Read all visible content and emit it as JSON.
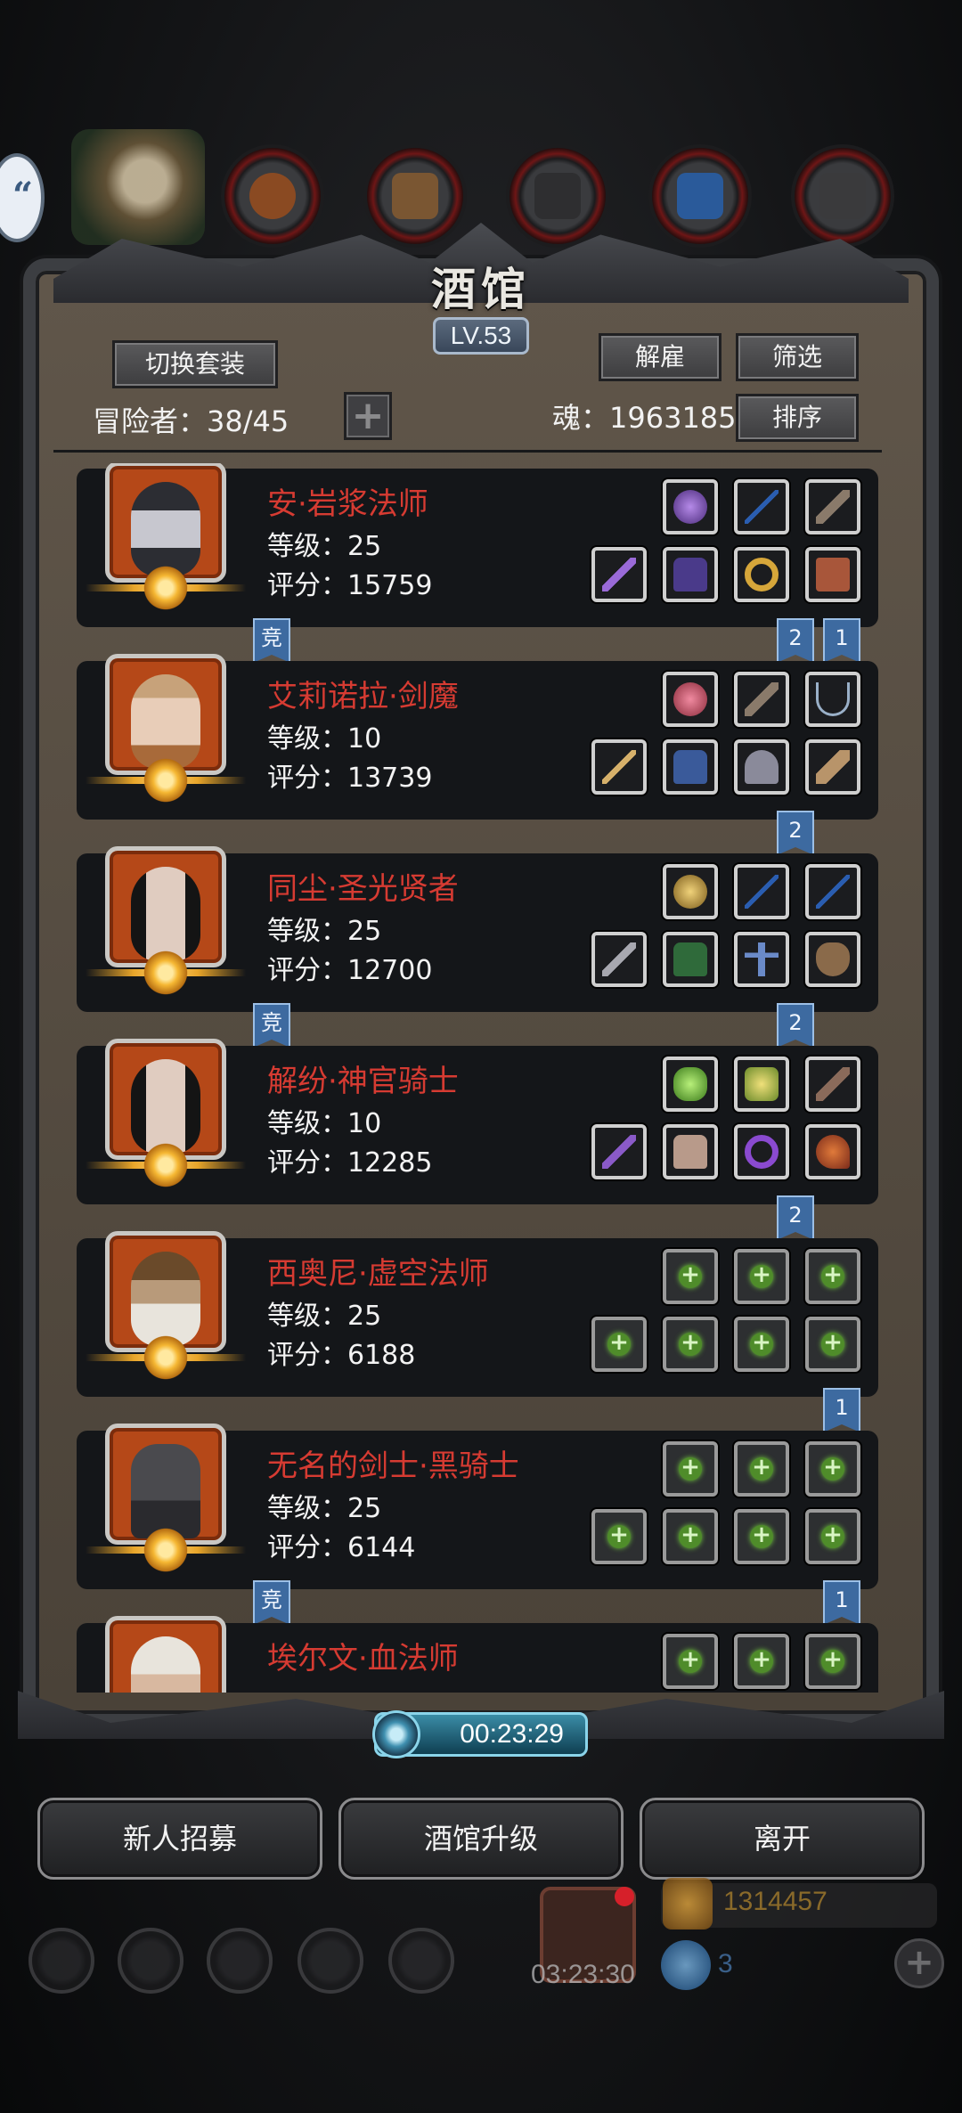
{
  "header": {
    "title": "酒馆",
    "level": "LV.53"
  },
  "toolbar": {
    "switch_outfit": "切换套装",
    "dismiss": "解雇",
    "filter": "筛选",
    "sort": "排序",
    "plus": "+",
    "adventurers_label": "冒险者：38/45",
    "soul_label": "魂：1963185"
  },
  "heroes": [
    {
      "name": "安·岩浆法师",
      "level": "等级：25",
      "score": "评分：15759",
      "tags": [
        "竞",
        "2",
        "1"
      ]
    },
    {
      "name": "艾莉诺拉·剑魔",
      "level": "等级：10",
      "score": "评分：13739",
      "tags": [
        "2"
      ]
    },
    {
      "name": "同尘·圣光贤者",
      "level": "等级：25",
      "score": "评分：12700",
      "tags": [
        "竞",
        "2"
      ]
    },
    {
      "name": "解纷·神官骑士",
      "level": "等级：10",
      "score": "评分：12285",
      "tags": [
        "2"
      ]
    },
    {
      "name": "西奥尼·虚空法师",
      "level": "等级：25",
      "score": "评分：6188",
      "tags": [
        "1"
      ]
    },
    {
      "name": "无名的剑士·黑骑士",
      "level": "等级：25",
      "score": "评分：6144",
      "tags": [
        "竞",
        "1"
      ]
    },
    {
      "name": "埃尔文·血法师",
      "level": "",
      "score": "",
      "tags": []
    }
  ],
  "timer": "00:23:29",
  "actions": {
    "recruit": "新人招募",
    "upgrade": "酒馆升级",
    "leave": "离开"
  },
  "background": {
    "gold": "1314457",
    "gems": "3",
    "gift_timer": "03:23:30"
  },
  "colors": {
    "hero_name": "#d63b32",
    "tag_blue": "#3d6aa0",
    "empty_slot_green": "#4f8c2a",
    "timer_cyan": "#3a8ca6"
  }
}
